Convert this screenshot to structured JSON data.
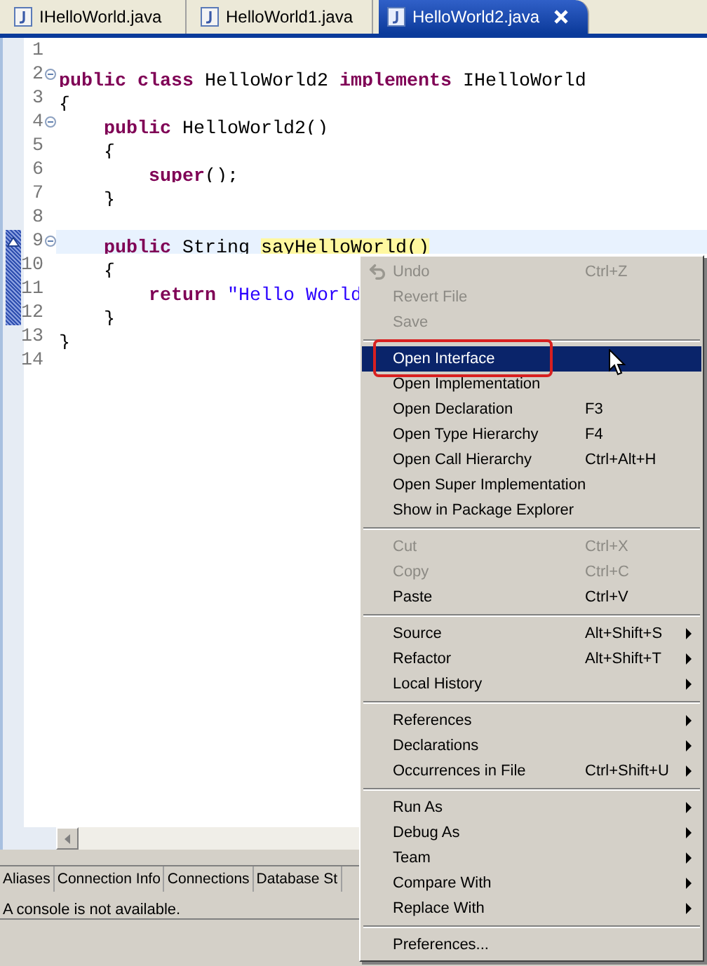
{
  "editor_tabs": [
    {
      "label": "IHelloWorld.java",
      "selected": false,
      "closable": false
    },
    {
      "label": "HelloWorld1.java",
      "selected": false,
      "closable": false
    },
    {
      "label": "HelloWorld2.java",
      "selected": true,
      "closable": true
    }
  ],
  "code_lines": [
    {
      "number": "1",
      "fold": false,
      "current": false,
      "marked": false,
      "override": false
    },
    {
      "number": "2",
      "fold": true,
      "current": false,
      "marked": false,
      "override": false,
      "tokens": [
        {
          "kind": "keyword",
          "text": "public class"
        },
        {
          "kind": "plain",
          "text": " HelloWorld2 "
        },
        {
          "kind": "keyword",
          "text": "implements"
        },
        {
          "kind": "plain",
          "text": " IHelloWorld"
        }
      ]
    },
    {
      "number": "3",
      "fold": false,
      "current": false,
      "marked": false,
      "override": false,
      "tokens": [
        {
          "kind": "plain",
          "text": "{"
        }
      ]
    },
    {
      "number": "4",
      "fold": true,
      "current": false,
      "marked": false,
      "override": false,
      "tokens": [
        {
          "kind": "keyword",
          "text": "    public"
        },
        {
          "kind": "plain",
          "text": " HelloWorld2()"
        }
      ]
    },
    {
      "number": "5",
      "fold": false,
      "current": false,
      "marked": false,
      "override": false,
      "tokens": [
        {
          "kind": "plain",
          "text": "    {"
        }
      ]
    },
    {
      "number": "6",
      "fold": false,
      "current": false,
      "marked": false,
      "override": false,
      "tokens": [
        {
          "kind": "keyword",
          "text": "        super"
        },
        {
          "kind": "plain",
          "text": "();"
        }
      ]
    },
    {
      "number": "7",
      "fold": false,
      "current": false,
      "marked": false,
      "override": false,
      "tokens": [
        {
          "kind": "plain",
          "text": "    }"
        }
      ]
    },
    {
      "number": "8",
      "fold": false,
      "current": false,
      "marked": false,
      "override": false
    },
    {
      "number": "9",
      "fold": true,
      "current": true,
      "marked": true,
      "override": true,
      "tokens": [
        {
          "kind": "keyword",
          "text": "    public"
        },
        {
          "kind": "plain",
          "text": " String "
        },
        {
          "kind": "occurrence",
          "text": "sayHelloWorld()"
        }
      ]
    },
    {
      "number": "10",
      "fold": false,
      "current": false,
      "marked": true,
      "override": false,
      "tokens": [
        {
          "kind": "plain",
          "text": "    {"
        }
      ]
    },
    {
      "number": "11",
      "fold": false,
      "current": false,
      "marked": true,
      "override": false,
      "tokens": [
        {
          "kind": "keyword",
          "text": "        return"
        },
        {
          "kind": "string",
          "text": " \"Hello World"
        }
      ]
    },
    {
      "number": "12",
      "fold": false,
      "current": false,
      "marked": true,
      "override": false,
      "tokens": [
        {
          "kind": "plain",
          "text": "    }"
        }
      ]
    },
    {
      "number": "13",
      "fold": false,
      "current": false,
      "marked": false,
      "override": false,
      "tokens": [
        {
          "kind": "plain",
          "text": "}"
        }
      ]
    },
    {
      "number": "14",
      "fold": false,
      "current": false,
      "marked": false,
      "override": false
    }
  ],
  "context_menu": {
    "items": [
      {
        "kind": "icon_item",
        "label": "Undo",
        "shortcut": "Ctrl+Z",
        "disabled": true,
        "selected": false,
        "submenu": false,
        "circled": false
      },
      {
        "kind": "item",
        "label": "Revert File",
        "disabled": true,
        "selected": false,
        "submenu": false,
        "circled": false
      },
      {
        "kind": "item",
        "label": "Save",
        "disabled": true,
        "selected": false,
        "submenu": false,
        "circled": false
      },
      {
        "kind": "separator"
      },
      {
        "kind": "item",
        "label": "Open Interface",
        "disabled": false,
        "selected": true,
        "submenu": false,
        "circled": true
      },
      {
        "kind": "item",
        "label": "Open Implementation",
        "disabled": false,
        "selected": false,
        "submenu": false,
        "circled": false
      },
      {
        "kind": "item",
        "label": "Open Declaration",
        "shortcut": "F3",
        "disabled": false,
        "selected": false,
        "submenu": false,
        "circled": false
      },
      {
        "kind": "item",
        "label": "Open Type Hierarchy",
        "shortcut": "F4",
        "disabled": false,
        "selected": false,
        "submenu": false,
        "circled": false
      },
      {
        "kind": "item",
        "label": "Open Call Hierarchy",
        "shortcut": "Ctrl+Alt+H",
        "disabled": false,
        "selected": false,
        "submenu": false,
        "circled": false
      },
      {
        "kind": "item",
        "label": "Open Super Implementation",
        "disabled": false,
        "selected": false,
        "submenu": false,
        "circled": false
      },
      {
        "kind": "item",
        "label": "Show in Package Explorer",
        "disabled": false,
        "selected": false,
        "submenu": false,
        "circled": false
      },
      {
        "kind": "separator"
      },
      {
        "kind": "item",
        "label": "Cut",
        "shortcut": "Ctrl+X",
        "disabled": true,
        "selected": false,
        "submenu": false,
        "circled": false
      },
      {
        "kind": "item",
        "label": "Copy",
        "shortcut": "Ctrl+C",
        "disabled": true,
        "selected": false,
        "submenu": false,
        "circled": false
      },
      {
        "kind": "item",
        "label": "Paste",
        "shortcut": "Ctrl+V",
        "disabled": false,
        "selected": false,
        "submenu": false,
        "circled": false
      },
      {
        "kind": "separator"
      },
      {
        "kind": "item",
        "label": "Source",
        "shortcut": "Alt+Shift+S",
        "disabled": false,
        "selected": false,
        "submenu": true,
        "circled": false
      },
      {
        "kind": "item",
        "label": "Refactor",
        "shortcut": "Alt+Shift+T",
        "disabled": false,
        "selected": false,
        "submenu": true,
        "circled": false
      },
      {
        "kind": "item",
        "label": "Local History",
        "disabled": false,
        "selected": false,
        "submenu": true,
        "circled": false
      },
      {
        "kind": "separator"
      },
      {
        "kind": "item",
        "label": "References",
        "disabled": false,
        "selected": false,
        "submenu": true,
        "circled": false
      },
      {
        "kind": "item",
        "label": "Declarations",
        "disabled": false,
        "selected": false,
        "submenu": true,
        "circled": false
      },
      {
        "kind": "item",
        "label": "Occurrences in File",
        "shortcut": "Ctrl+Shift+U",
        "disabled": false,
        "selected": false,
        "submenu": true,
        "circled": false
      },
      {
        "kind": "separator"
      },
      {
        "kind": "item",
        "label": "Run As",
        "disabled": false,
        "selected": false,
        "submenu": true,
        "circled": false
      },
      {
        "kind": "item",
        "label": "Debug As",
        "disabled": false,
        "selected": false,
        "submenu": true,
        "circled": false
      },
      {
        "kind": "item",
        "label": "Team",
        "disabled": false,
        "selected": false,
        "submenu": true,
        "circled": false
      },
      {
        "kind": "item",
        "label": "Compare With",
        "disabled": false,
        "selected": false,
        "submenu": true,
        "circled": false
      },
      {
        "kind": "item",
        "label": "Replace With",
        "disabled": false,
        "selected": false,
        "submenu": true,
        "circled": false
      },
      {
        "kind": "separator"
      },
      {
        "kind": "item",
        "label": "Preferences...",
        "disabled": false,
        "selected": false,
        "submenu": false,
        "circled": false
      }
    ]
  },
  "bottom_panel": {
    "tabs": [
      {
        "label": "Aliases"
      },
      {
        "label": "Connection Info"
      },
      {
        "label": "Connections"
      },
      {
        "label": "Database St"
      }
    ],
    "message": "A console is not available."
  }
}
